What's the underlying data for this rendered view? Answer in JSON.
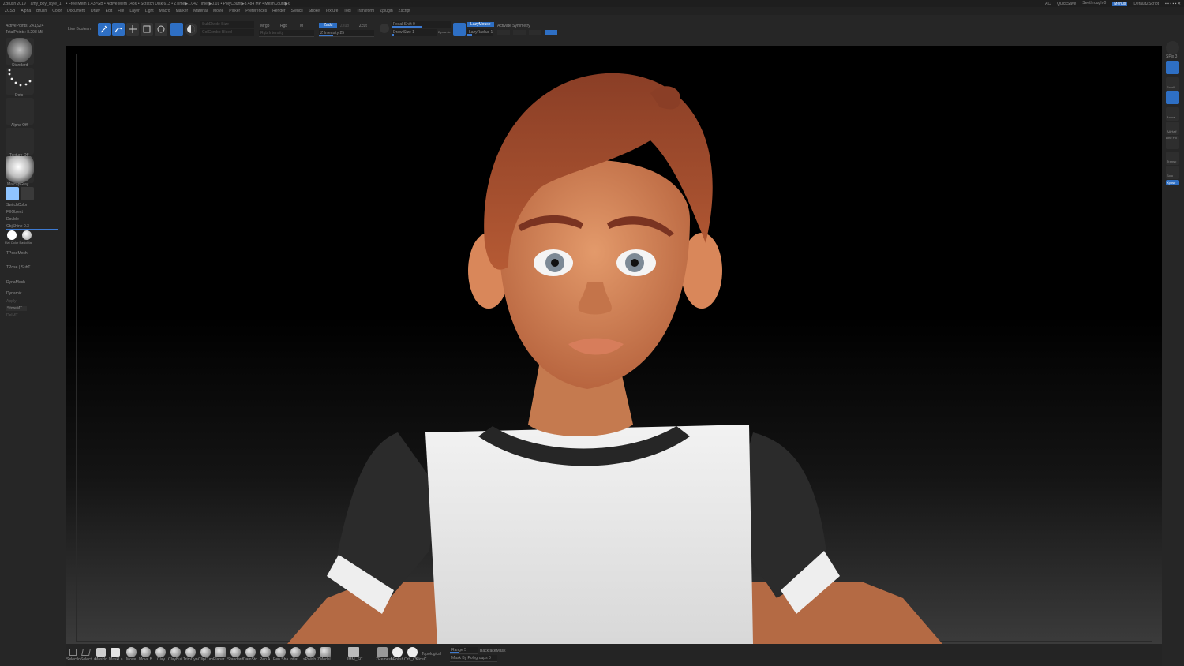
{
  "titlebar": {
    "app": "ZBrush 2019",
    "doc": "amy_boy_style_1",
    "stats": "• Free Mem 1.437GB • Active Mem 1486 • Scratch Disk 613 • ZTime▶1.042 Timer▶0.01 • PolyCount▶8.484 MP • MeshCount▶6",
    "ac": "AC",
    "quicksave": "QuickSave",
    "seethrough": "Seethrough  0",
    "menus_label": "Menus",
    "script": "DefaultZScript"
  },
  "menubar": [
    "ZCSB",
    "Alpha",
    "Brush",
    "Color",
    "Document",
    "Draw",
    "Edit",
    "File",
    "Layer",
    "Light",
    "Macro",
    "Marker",
    "Material",
    "Movie",
    "Picker",
    "Preferences",
    "Render",
    "Stencil",
    "Stroke",
    "Texture",
    "Tool",
    "Transform",
    "Zplugin",
    "Zscript"
  ],
  "topshelf": {
    "active_points": "ActivePoints: 241,924",
    "total_points": "TotalPoints: 8.298 Mil",
    "live_boolean": "Live Boolean",
    "edit": "Edit",
    "draw": "Draw",
    "move": "Move",
    "scale": "Scale",
    "rotate": "Rotate",
    "sub_intensity": "SubDivide Size",
    "col_intensity": "ColCombo Bleed",
    "mrgb": "Mrgb",
    "rgb": "Rgb",
    "m": "M",
    "rgb_intensity": "Rgb Intensity",
    "zadd": "Zadd",
    "zsub": "Zsub",
    "zcut": "Zcut",
    "z_intensity": "Z Intensity 25",
    "focal_shift": "Focal Shift 0",
    "draw_size": "Draw Size 1",
    "dynamic": "Dynamic",
    "lazymouse": "LazyMouse",
    "lazyradius": "LazyRadius 1",
    "activate_symmetry": "Activate Symmetry"
  },
  "leftshelf": {
    "standard": "Standard",
    "dots": "Dots",
    "alpha_off": "Alpha Off",
    "texture_off": "Texture Off",
    "matcap": "MatcapGray",
    "switch_color": "SwitchColor",
    "fill_object": "FillObject",
    "double": "Double",
    "obj_shine": "ObjShine 0.3",
    "blend": "Flat Color  BasicMat",
    "tpose": "TPoseMesh",
    "tpose_subt": "TPose | SubT",
    "dynamesh": "DynaMesh",
    "dynamic": "Dynamic",
    "apply": "Apply",
    "store_mt": "StoreMT",
    "del_mt": "DelMT"
  },
  "rightshelf": [
    "SPix 3",
    "Scroll",
    "Zoom",
    "Actual",
    "AAHalf",
    "Persp",
    "Floor",
    "Local",
    "Line Fill",
    "PolyF",
    "Transp",
    "Ghost",
    "Solo",
    "Xpose"
  ],
  "bottomshelf": {
    "select_label": "SelectRt",
    "brushes": [
      "Selectlo",
      "SelectLa",
      "Masklo",
      "MaskLa",
      "Move",
      "Move B",
      "Clay",
      "ClayBuil",
      "TrimDyn",
      "ClipCurv",
      "Planar",
      "Standard",
      "DamStd",
      "Pen A",
      "Pen Sha",
      "Inflat",
      "sPolish",
      "ZModel"
    ],
    "imm": "IMM_SC",
    "zremesh": "ZRemesh",
    "hpolish": "hPolish",
    "orb": "Orb_Cr",
    "cut": "SliceC",
    "topological": "Topological",
    "range": "Range 5",
    "backface_mask": "BackfaceMask",
    "mask_by_polygroups": "Mask By Polygroups 0"
  },
  "colors": {
    "accent": "#2e6fc4",
    "panel": "#262626",
    "viewport_top": "#000000"
  }
}
